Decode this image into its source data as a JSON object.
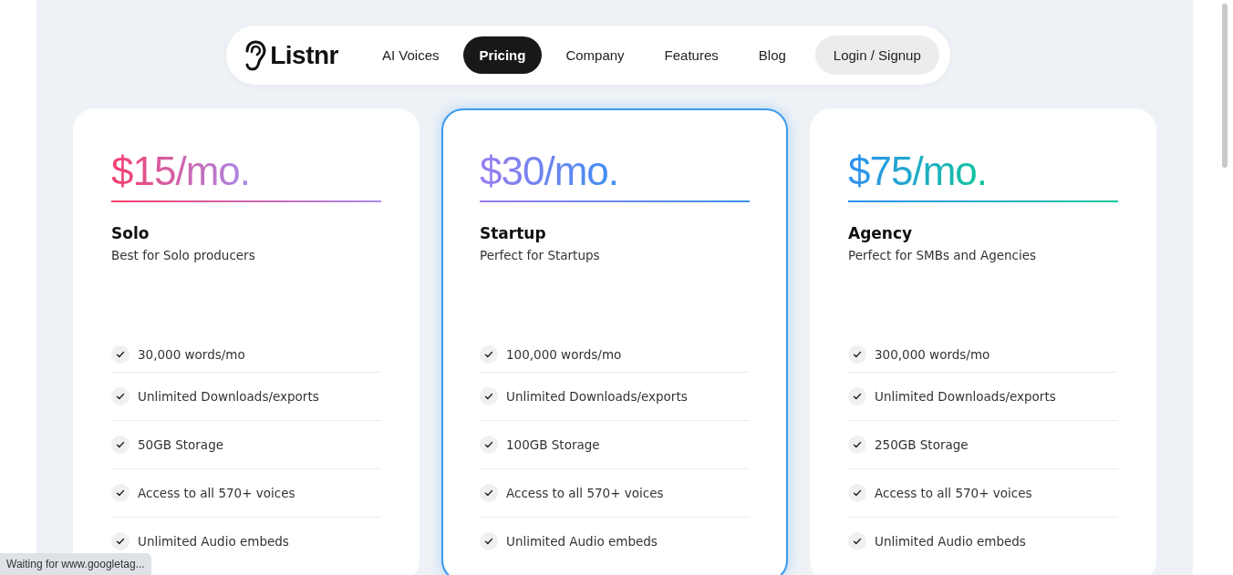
{
  "nav": {
    "logo": "Listnr",
    "items": [
      {
        "label": "AI Voices",
        "selected": false,
        "kind": "link"
      },
      {
        "label": "Pricing",
        "selected": true,
        "kind": "link"
      },
      {
        "label": "Company",
        "selected": false,
        "kind": "link"
      },
      {
        "label": "Features",
        "selected": false,
        "kind": "link"
      },
      {
        "label": "Blog",
        "selected": false,
        "kind": "link"
      },
      {
        "label": "Login / Signup",
        "selected": false,
        "kind": "button"
      }
    ]
  },
  "plans": [
    {
      "price": "$15/mo.",
      "name": "Solo",
      "description": "Best for Solo producers",
      "selected": false,
      "features": [
        "30,000 words/mo",
        "Unlimited Downloads/exports",
        "50GB Storage",
        "Access to all 570+ voices",
        "Unlimited Audio embeds"
      ]
    },
    {
      "price": "$30/mo.",
      "name": "Startup",
      "description": "Perfect for Startups",
      "selected": true,
      "features": [
        "100,000 words/mo",
        "Unlimited Downloads/exports",
        "100GB Storage",
        "Access to all 570+ voices",
        "Unlimited Audio embeds"
      ]
    },
    {
      "price": "$75/mo.",
      "name": "Agency",
      "description": "Perfect for SMBs and Agencies",
      "selected": false,
      "features": [
        "300,000 words/mo",
        "Unlimited Downloads/exports",
        "250GB Storage",
        "Access to all 570+ voices",
        "Unlimited Audio embeds"
      ]
    }
  ],
  "status_bar": "Waiting for www.googletag..."
}
